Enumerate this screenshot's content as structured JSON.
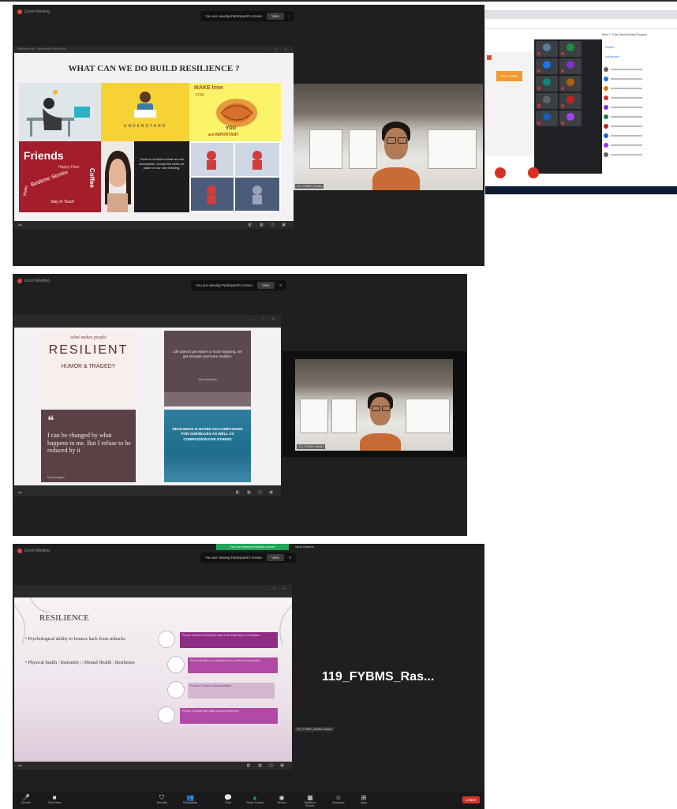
{
  "screens": [
    {
      "app_name": "Zoom Meeting",
      "share_notice": "You are viewing Participant's screen",
      "share_button": "View",
      "slide": {
        "title": "WHAT CAN WE DO BUILD RESILIENCE ?",
        "tile_understand": "UNDERSTAND",
        "tile_make_time": "MAKE time",
        "tile_for": "FOR",
        "tile_you": "YOU",
        "tile_important": "are IMPORTANT",
        "word_friends": "Friends",
        "word_coffee": "Coffee",
        "word_bedtime": "Bedtime Stories",
        "word_happy": "Happy Hour",
        "word_stay": "Stay In Touch",
        "word_walks": "Walks",
        "quote": "There is no limit to what we can accomplish, except the limits we place on our own thinking."
      },
      "presenter_window_title": "Resilience ppt - PowerPoint Slide Show",
      "camera_label": "119_FYBMS_Rasika"
    },
    {
      "app_name": "Zoom Meeting",
      "share_notice": "You are viewing Participant's screen",
      "share_button": "View",
      "slide": {
        "what_makes": "what makes people",
        "resilient": "RESILIENT",
        "humor": "HUMOR & TRAGEDY",
        "quote_top": "Life doesn't get easier or more forgiving, we get stronger and more resilient.",
        "quote_author_top": "Steve Maraboli",
        "quote_left": "I can be changed by what happens to me. But I refuse to be reduced by it",
        "quote_left_author": "Maya Angelou",
        "quote_right": "RESILIENCE IS BASED ON COMPASSION FOR OURSELVES AS WELL AS COMPASSION FOR OTHERS"
      },
      "camera_label": "119_FYBMS_Rasika"
    },
    {
      "app_name": "Zoom Meeting",
      "share_notice": "You are viewing Participant's screen",
      "share_button": "View",
      "green_banner": "You are viewing Rasika's screen",
      "view_options": "View Options",
      "slide": {
        "title": "RESILIENCE",
        "bullet_1": "Psychological ability to bounce back from setbacks",
        "bullet_2": "Physical health : Immunity :: Mental Health : Resilience",
        "box_1": "Person A starts to thinking it wasn't the challenges of a situation",
        "box_2": "Person B starts on a situation from a different perspective",
        "box_3": "Person C tends to think positively",
        "box_4": "Person D builds their skills through experience"
      },
      "participant_name": "119_FYBMS_Ras...",
      "small_label": "119_FYBMS_Rasika Kalyani",
      "toolbar": [
        "Unmute",
        "Start Video",
        "Security",
        "Participants",
        "Chat",
        "Share Screen",
        "Record",
        "Breakout Rooms",
        "Reactions",
        "Apps"
      ],
      "leave": "Leave"
    }
  ],
  "browser": {
    "title": "Dear 1. Pune Dept Building Program",
    "badge_text": "UGC CARE",
    "people_tab": "People",
    "add_people": "Add people"
  }
}
